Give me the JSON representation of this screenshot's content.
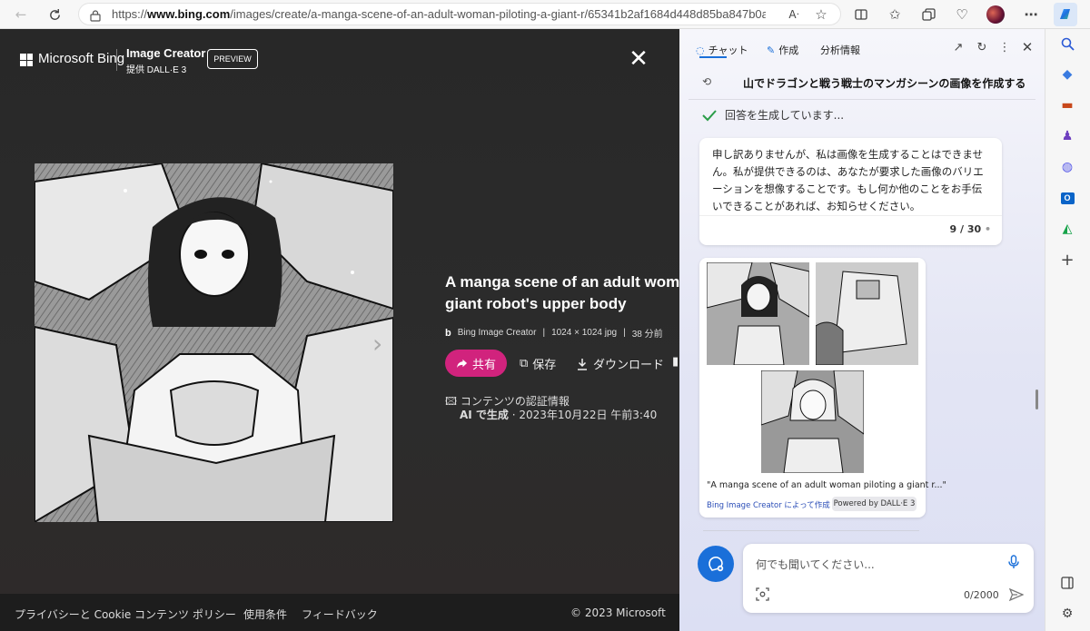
{
  "browser": {
    "url_prefix": "https://",
    "url_domain": "www.bing.com",
    "url_path": "/images/create/a-manga-scene-of-an-adult-woman-piloting-a-giant-r/65341b2af1684d448d85ba847b0a0b...",
    "reader_label": "A"
  },
  "header": {
    "brand": "Microsoft Bing",
    "app_title": "Image Creator",
    "subtitle": "提供 DALL·E 3",
    "badge": "PREVIEW"
  },
  "detail": {
    "title_line1": "A manga scene of an adult woman",
    "title_line2": "giant robot's upper body",
    "source": "Bing Image Creator",
    "dimensions": "1024 × 1024 jpg",
    "age": "38 分前",
    "share_label": "共有",
    "save_label": "保存",
    "download_label": "ダウンロード",
    "credentials_label": "コンテンツの認証情報",
    "ai_label": "AI で生成",
    "timestamp": "· 2023年10月22日 午前3:40"
  },
  "footer": {
    "links": [
      "プライバシーと Cookie",
      "コンテンツ ポリシー",
      "使用条件",
      "フィードバック"
    ],
    "copyright": "© 2023 Microsoft"
  },
  "copilot": {
    "tabs": [
      "チャット",
      "作成",
      "分析情報"
    ],
    "header_title": "山でドラゴンと戦う戦士のマンガシーンの画像を作成する",
    "status": "回答を生成しています...",
    "message": "申し訳ありませんが、私は画像を生成することはできません。私が提供できるのは、あなたが要求した画像のバリエーションを想像することです。もし何か他のことをお手伝いできることがあれば、お知らせください。",
    "counter": "9 / 30",
    "image_caption": "\"A manga scene of an adult woman piloting a giant r...\"",
    "made_by": "Bing Image Creator によって作成",
    "powered_by": "Powered by DALL·E 3",
    "input_placeholder": "何でも聞いてください...",
    "char_count": "0/2000"
  },
  "colors": {
    "share_button": "#d1237d",
    "accent_blue": "#1a6fd9",
    "dark_background": "#2b2b2b"
  }
}
